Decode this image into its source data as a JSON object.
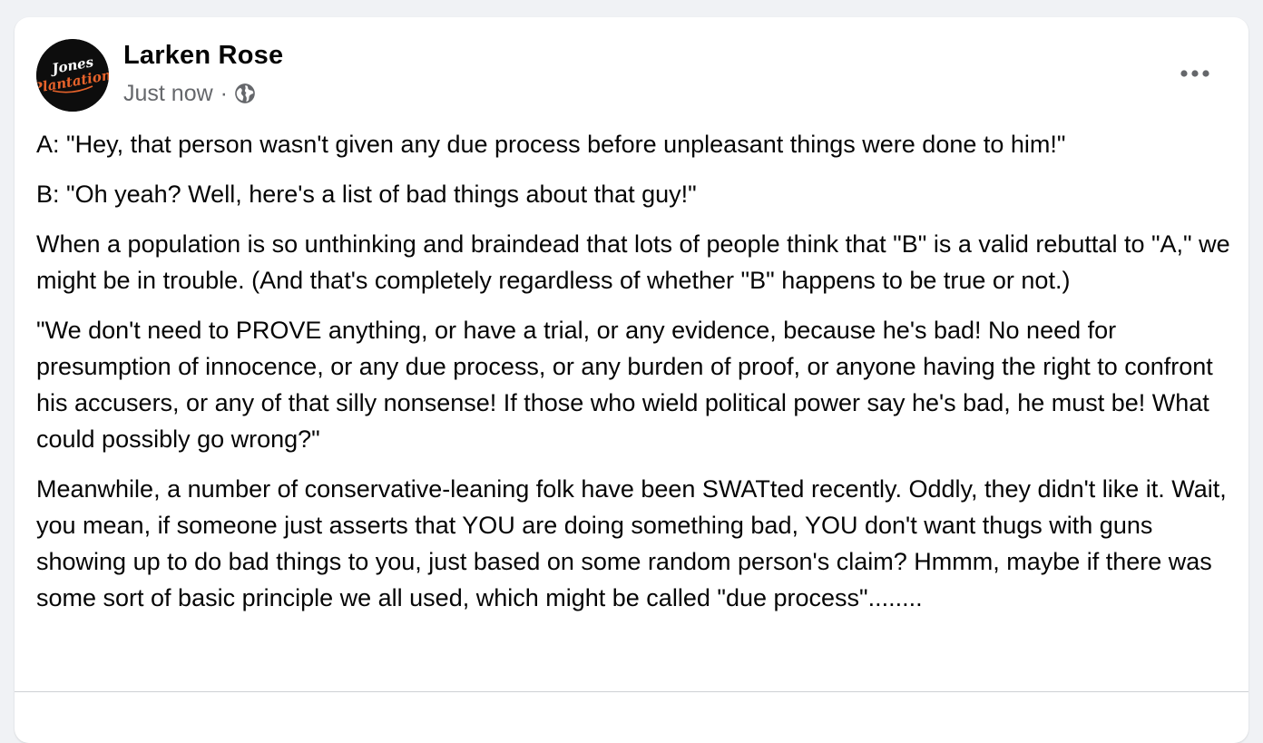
{
  "post": {
    "author": "Larken Rose",
    "timestamp": "Just now",
    "separator": "·",
    "privacy_icon": "globe-icon",
    "avatar_logo_text": "Jones Plantation",
    "more_icon": "more-horizontal-icon",
    "paragraphs": [
      "A: \"Hey, that person wasn't given any due process before unpleasant things were done to him!\"",
      "B: \"Oh yeah? Well, here's a list of bad things about that guy!\"",
      "When a population is so unthinking and braindead that lots of people think that \"B\" is a valid rebuttal to \"A,\" we might be in trouble. (And that's completely regardless of whether \"B\" happens to be true or not.)",
      "\"We don't need to PROVE anything, or have a trial, or any evidence, because he's bad! No need for presumption of innocence, or any due process, or any burden of proof, or anyone having the right to confront his accusers, or any of that silly nonsense! If those who wield political power say he's bad, he must be! What could possibly go wrong?\"",
      "Meanwhile, a number of conservative-leaning folk have been SWATted recently. Oddly, they didn't like it. Wait, you mean, if someone just asserts that YOU are doing something bad, YOU don't want thugs with guns showing up to do bad things to you, just based on some random person's claim? Hmmm, maybe if there was some sort of basic principle we all used, which might be called \"due process\"........"
    ]
  },
  "colors": {
    "background": "#f0f2f5",
    "card": "#ffffff",
    "text": "#050505",
    "secondary_text": "#65676b",
    "avatar_bg": "#0d0d0d",
    "logo_orange": "#e8632b"
  }
}
